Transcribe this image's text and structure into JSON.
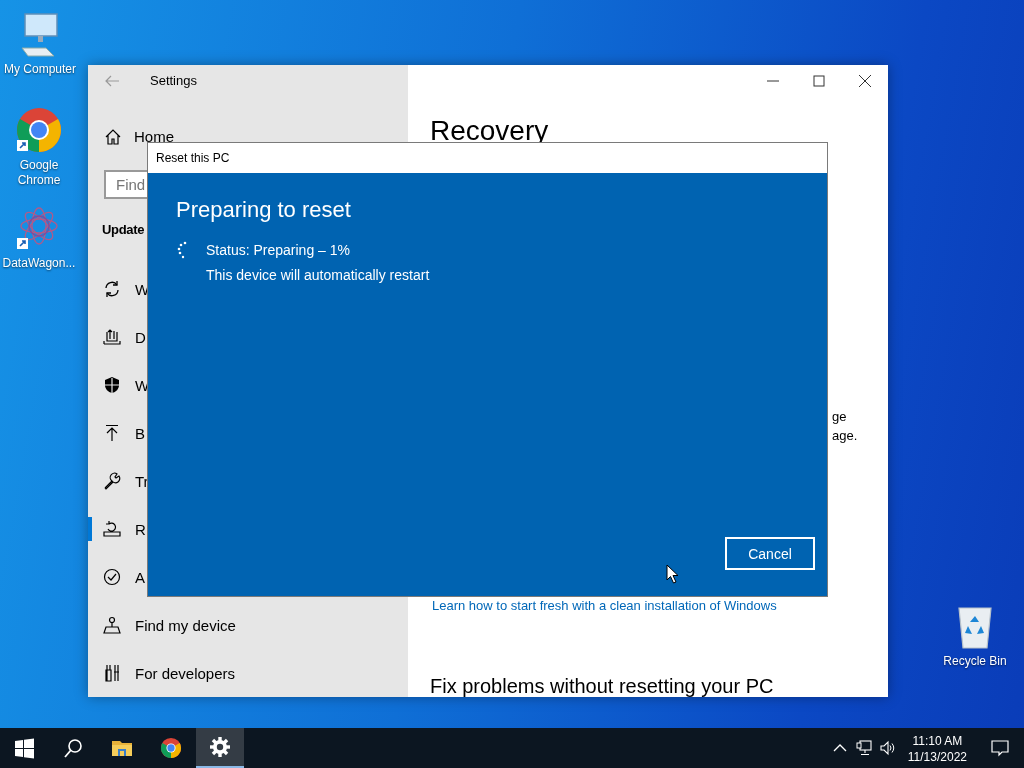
{
  "desktop": {
    "icons": [
      {
        "kind": "computer",
        "label": "My Computer"
      },
      {
        "kind": "chrome",
        "label": "Google Chrome"
      },
      {
        "kind": "app",
        "label": "DataWagon..."
      },
      {
        "kind": "recycle",
        "label": "Recycle Bin"
      }
    ]
  },
  "settings_window": {
    "title": "Settings",
    "sidebar": {
      "home": "Home",
      "search": {
        "placeholder": "Find"
      },
      "section": "Update",
      "items": [
        {
          "kind": "sync",
          "label": "W",
          "selected": false
        },
        {
          "kind": "delivery",
          "label": "D",
          "selected": false
        },
        {
          "kind": "shield",
          "label": "W",
          "selected": false
        },
        {
          "kind": "backup",
          "label": "B",
          "selected": false
        },
        {
          "kind": "troubleshoot",
          "label": "Tr",
          "selected": false
        },
        {
          "kind": "recovery",
          "label": "R",
          "selected": true
        },
        {
          "kind": "activation",
          "label": "A",
          "selected": false
        },
        {
          "kind": "find",
          "label": "Find my device",
          "selected": false
        },
        {
          "kind": "developers",
          "label": "For developers",
          "selected": false
        }
      ]
    },
    "content": {
      "title": "Recovery",
      "text_lines": [
        "ge",
        "age."
      ],
      "link": "Learn how to start fresh with a clean installation of Windows",
      "heading": "Fix problems without resetting your PC"
    }
  },
  "dialog": {
    "title": "Reset this PC",
    "heading": "Preparing to reset",
    "status": "Status: Preparing – 1%",
    "message": "This device will automatically restart",
    "buttons": [
      "Cancel"
    ]
  },
  "taskbar": {
    "apps": [
      {
        "kind": "start",
        "selected": false
      },
      {
        "kind": "search",
        "selected": false
      },
      {
        "kind": "explorer",
        "selected": false
      },
      {
        "kind": "chrome",
        "selected": false
      },
      {
        "kind": "settings",
        "selected": true
      }
    ],
    "time": "11:10 AM",
    "date": "11/13/2022"
  }
}
